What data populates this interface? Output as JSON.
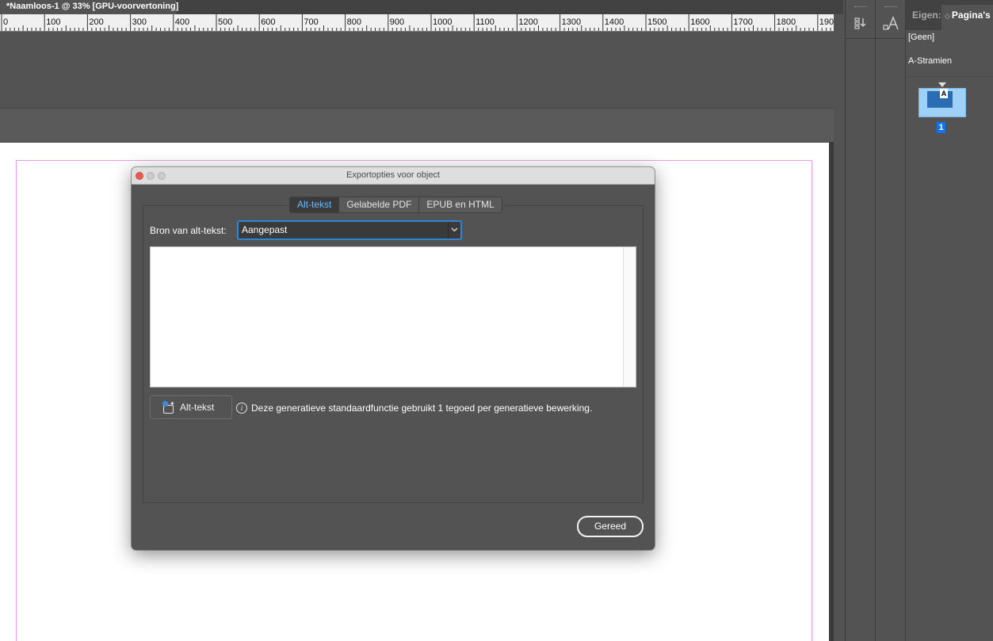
{
  "document_tab": {
    "title": "*Naamloos-1 @ 33% [GPU-voorvertoning]"
  },
  "ruler": {
    "labels": [
      "0",
      "100",
      "200",
      "300",
      "400",
      "500",
      "600",
      "700",
      "800",
      "900",
      "1000",
      "1100",
      "1200",
      "1300",
      "1400",
      "1500",
      "1600",
      "1700",
      "1800",
      "190"
    ]
  },
  "tool_strips": {
    "strip1_icon": "swap-direction-icon",
    "strip2_icon": "character-styles-icon"
  },
  "pages_panel": {
    "tab_inactive": "Eigen:",
    "tab_active": "Pagina's",
    "tab_active_icon": "◇",
    "none_label": "[Geen]",
    "master_label": "A-Stramien",
    "master_letter": "A",
    "page_number": "1"
  },
  "dialog": {
    "title": "Exportopties voor object",
    "tabs": [
      {
        "label": "Alt-tekst",
        "active": true
      },
      {
        "label": "Gelabelde PDF",
        "active": false
      },
      {
        "label": "EPUB en HTML",
        "active": false
      }
    ],
    "source_label": "Bron van alt-tekst:",
    "source_value": "Aangepast",
    "alt_text_value": "",
    "generate_button": "Alt-tekst",
    "info_text": "Deze generatieve standaardfunctie gebruikt 1 tegoed per generatieve bewerking.",
    "done_button": "Gereed"
  },
  "colors": {
    "accent": "#1473e6",
    "active_tab_text": "#6bb7ff",
    "margin_guide": "#e3a0e0",
    "close_button": "#ee5a52"
  }
}
